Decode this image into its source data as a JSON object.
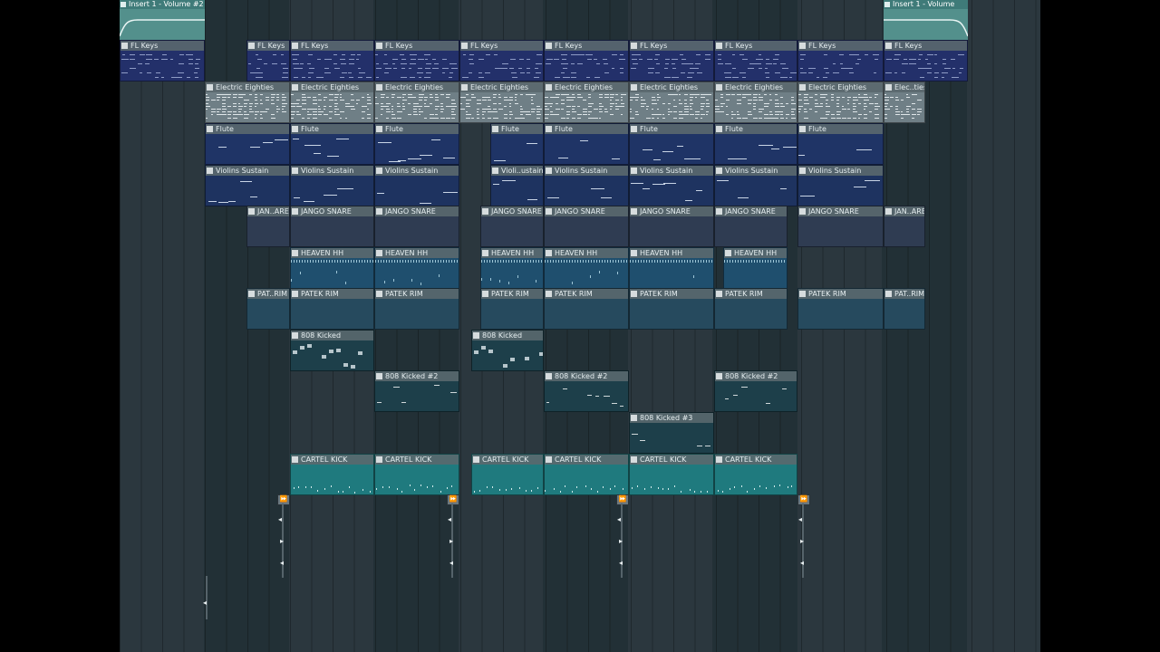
{
  "app": "FL Studio",
  "view": "Playlist",
  "colors": {
    "background": "#2b373e",
    "fl_keys": "#23306a",
    "electric_eighties": "#6f7f86",
    "flute": "#1f3466",
    "violins": "#1e3360",
    "snare": "#2f3c52",
    "hihat": "#1f4f6e",
    "rim": "#264a5e",
    "kick_808": "#1d3f4a",
    "cartel_kick": "#1f7a7e",
    "automation": "#53908c"
  },
  "automation_clips": [
    {
      "label": "Insert 1 - Volume #2"
    },
    {
      "label": "Insert 1 - Volume"
    }
  ],
  "tracks": [
    {
      "name": "fl_keys",
      "clips": [
        {
          "label": "FL Keys"
        },
        {
          "label": "FL Keys"
        },
        {
          "label": "FL Keys"
        },
        {
          "label": "FL Keys"
        },
        {
          "label": "FL Keys"
        },
        {
          "label": "FL Keys"
        },
        {
          "label": "FL Keys"
        },
        {
          "label": "FL Keys"
        },
        {
          "label": "FL Keys"
        },
        {
          "label": "FL Keys"
        }
      ]
    },
    {
      "name": "electric_eighties",
      "clips": [
        {
          "label": "Electric Eighties"
        },
        {
          "label": "Electric Eighties"
        },
        {
          "label": "Electric Eighties"
        },
        {
          "label": "Electric Eighties"
        },
        {
          "label": "Electric Eighties"
        },
        {
          "label": "Electric Eighties"
        },
        {
          "label": "Electric Eighties"
        },
        {
          "label": "Electric Eighties"
        },
        {
          "label": "Elec..ties"
        }
      ]
    },
    {
      "name": "flute",
      "clips": [
        {
          "label": "Flute"
        },
        {
          "label": "Flute"
        },
        {
          "label": "Flute"
        },
        {
          "label": "Flute"
        },
        {
          "label": "Flute"
        },
        {
          "label": "Flute"
        },
        {
          "label": "Flute"
        },
        {
          "label": "Flute"
        }
      ]
    },
    {
      "name": "violins_sustain",
      "clips": [
        {
          "label": "Violins Sustain"
        },
        {
          "label": "Violins Sustain"
        },
        {
          "label": "Violins Sustain"
        },
        {
          "label": "Violi..ustain"
        },
        {
          "label": "Violins Sustain"
        },
        {
          "label": "Violins Sustain"
        },
        {
          "label": "Violins Sustain"
        },
        {
          "label": "Violins Sustain"
        }
      ]
    },
    {
      "name": "jango_snare",
      "clips": [
        {
          "label": "JAN..ARE"
        },
        {
          "label": "JANGO SNARE"
        },
        {
          "label": "JANGO SNARE"
        },
        {
          "label": "JANGO SNARE"
        },
        {
          "label": "JANGO SNARE"
        },
        {
          "label": "JANGO SNARE"
        },
        {
          "label": "JANGO SNARE"
        },
        {
          "label": "JANGO SNARE"
        },
        {
          "label": "JAN..ARE"
        }
      ]
    },
    {
      "name": "heaven_hh",
      "clips": [
        {
          "label": "HEAVEN HH"
        },
        {
          "label": "HEAVEN HH"
        },
        {
          "label": "HEAVEN HH"
        },
        {
          "label": "HEAVEN HH"
        },
        {
          "label": "HEAVEN HH"
        },
        {
          "label": "HEAVEN HH"
        }
      ]
    },
    {
      "name": "patek_rim",
      "clips": [
        {
          "label": "PAT..RIM"
        },
        {
          "label": "PATEK RIM"
        },
        {
          "label": "PATEK RIM"
        },
        {
          "label": "PATEK RIM"
        },
        {
          "label": "PATEK RIM"
        },
        {
          "label": "PATEK RIM"
        },
        {
          "label": "PATEK RIM"
        },
        {
          "label": "PATEK RIM"
        },
        {
          "label": "PAT..RIM"
        }
      ]
    },
    {
      "name": "808_kicked",
      "clips": [
        {
          "label": "808 Kicked"
        },
        {
          "label": "808 Kicked"
        }
      ]
    },
    {
      "name": "808_kicked_2",
      "clips": [
        {
          "label": "808 Kicked #2"
        },
        {
          "label": "808 Kicked #2"
        },
        {
          "label": "808 Kicked #2"
        }
      ]
    },
    {
      "name": "808_kicked_3",
      "clips": [
        {
          "label": "808 Kicked #3"
        }
      ]
    },
    {
      "name": "cartel_kick",
      "clips": [
        {
          "label": "CARTEL KICK"
        },
        {
          "label": "CARTEL KICK"
        },
        {
          "label": "CARTEL KICK"
        },
        {
          "label": "CARTEL KICK"
        },
        {
          "label": "CARTEL KICK"
        },
        {
          "label": "CARTEL KICK"
        }
      ]
    }
  ],
  "markers": [
    {
      "icon": "fast-forward-icon"
    },
    {
      "icon": "fast-forward-icon"
    },
    {
      "icon": "fast-forward-icon"
    },
    {
      "icon": "fast-forward-icon"
    }
  ]
}
